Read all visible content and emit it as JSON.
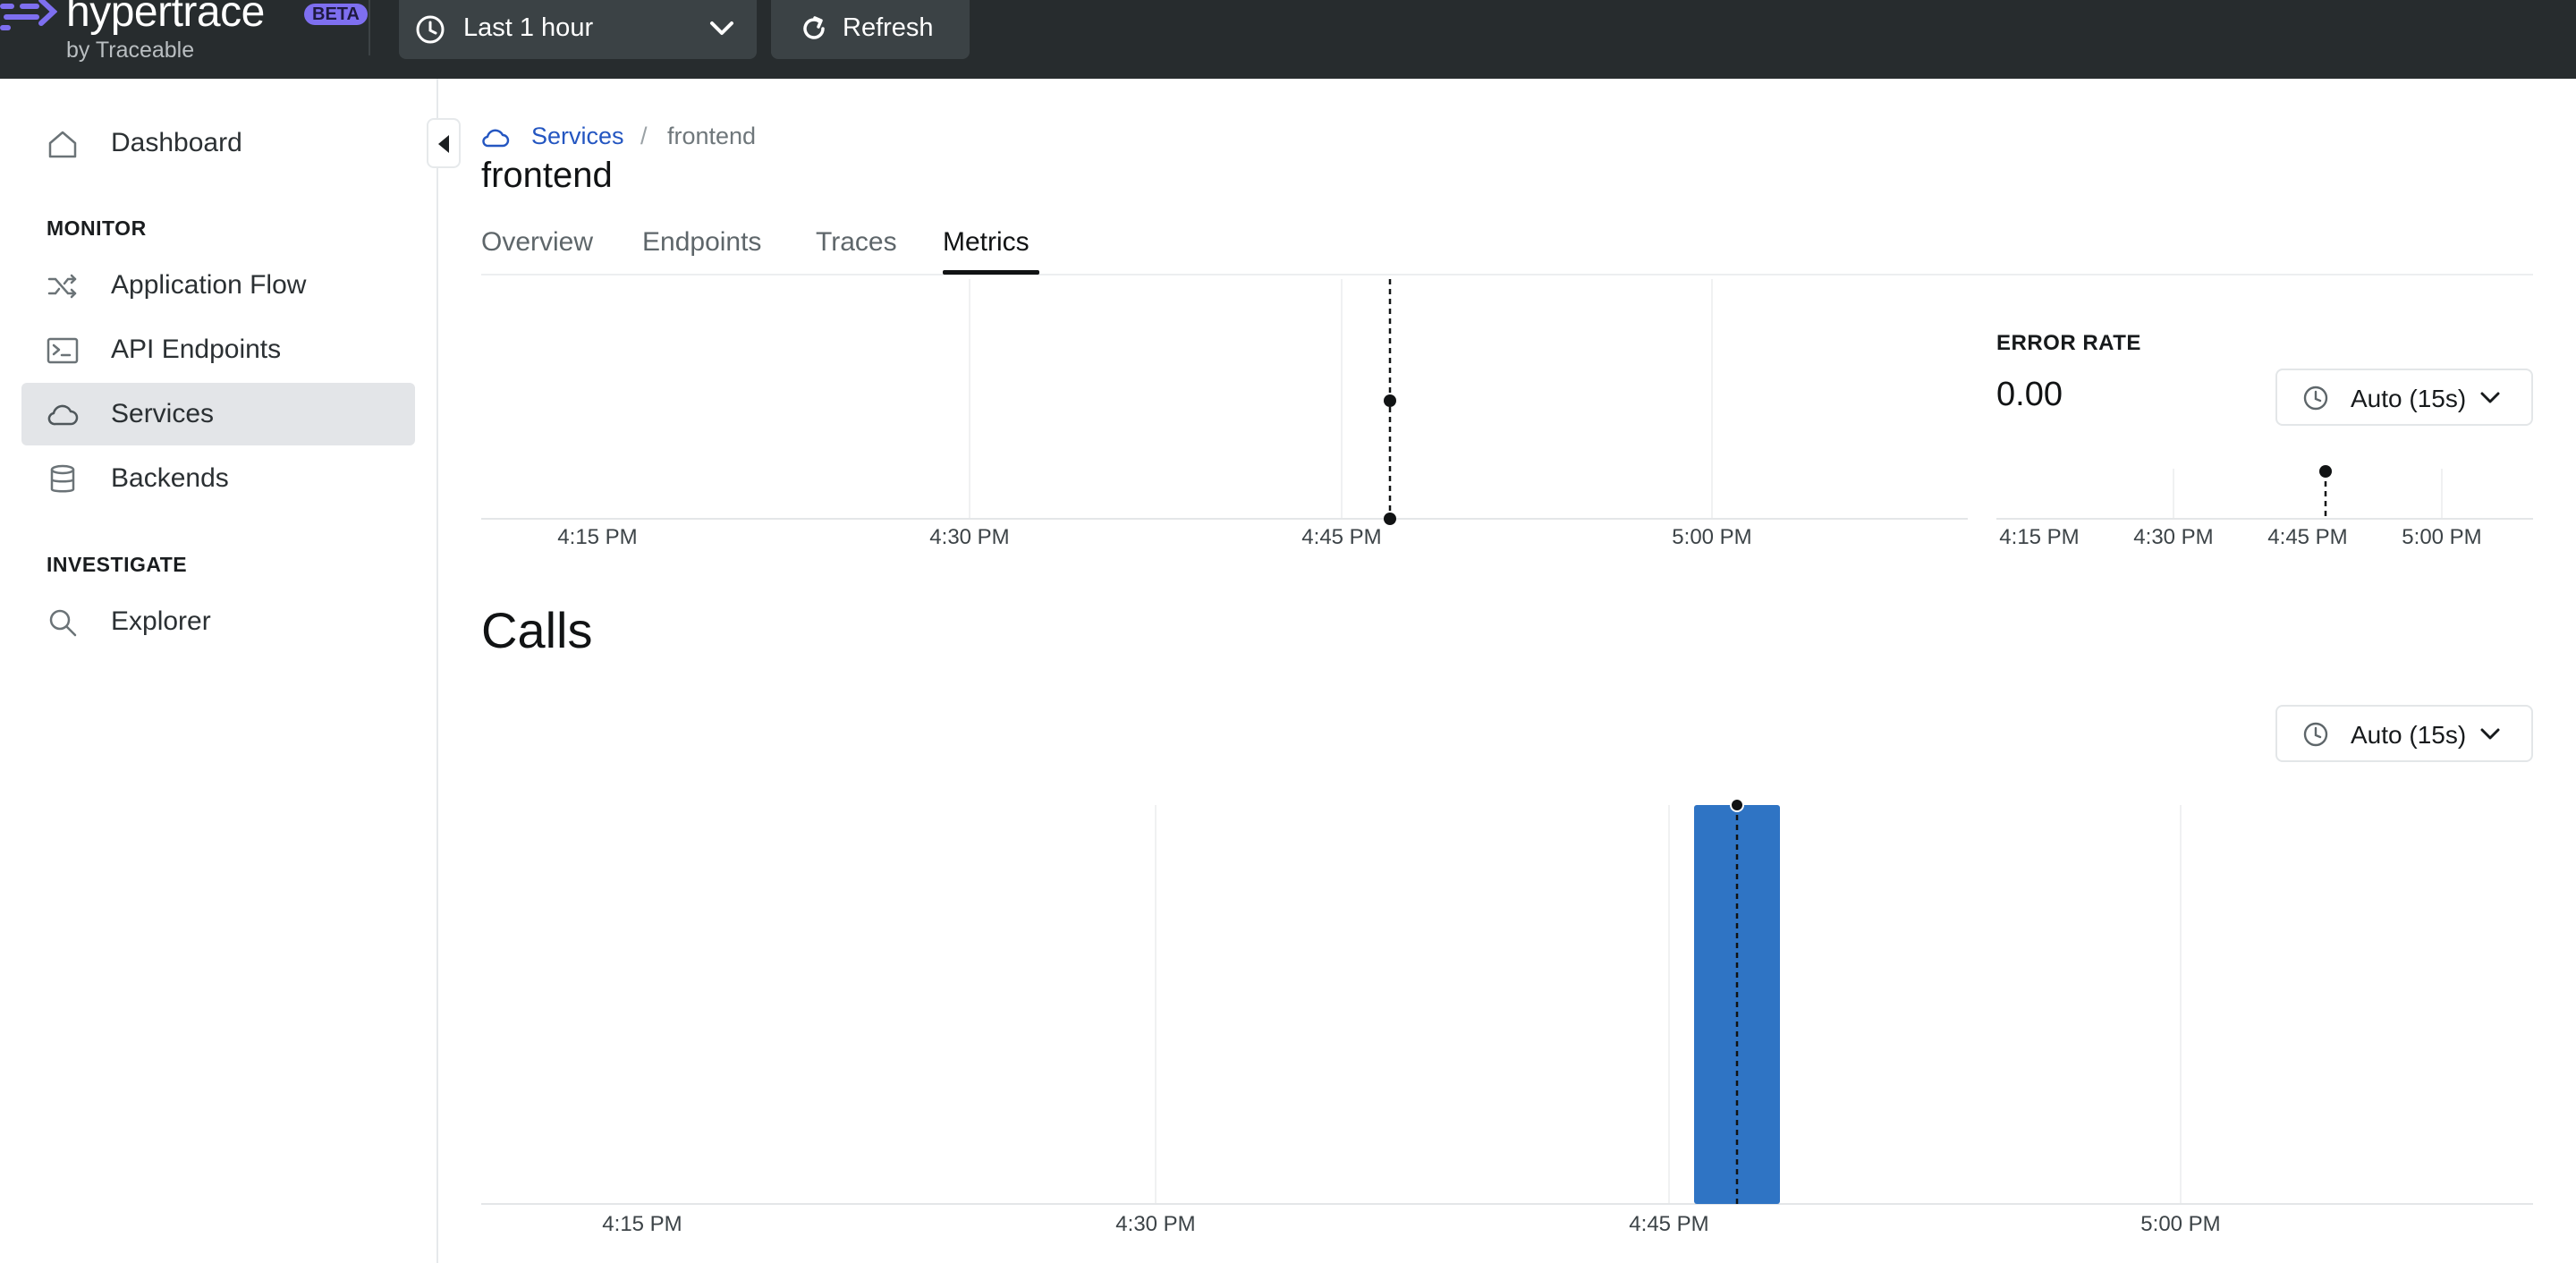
{
  "topbar": {
    "brand": "hypertrace",
    "beta": "BETA",
    "byline": "by Traceable",
    "time_range": "Last 1 hour",
    "refresh_label": "Refresh"
  },
  "sidebar": {
    "items": {
      "dashboard": "Dashboard",
      "application_flow": "Application Flow",
      "api_endpoints": "API Endpoints",
      "services": "Services",
      "backends": "Backends",
      "explorer": "Explorer"
    },
    "sections": {
      "monitor": "MONITOR",
      "investigate": "INVESTIGATE"
    },
    "active": "services"
  },
  "breadcrumb": {
    "link": "Services",
    "separator": "/",
    "current": "frontend"
  },
  "page_title": "frontend",
  "tabs": {
    "overview": "Overview",
    "endpoints": "Endpoints",
    "traces": "Traces",
    "metrics": "Metrics"
  },
  "active_tab": "Metrics",
  "colors": {
    "topbar": "#272c2e",
    "accent": "#7e6ff0",
    "link": "#2456c1",
    "bar": "#2f74c4"
  },
  "error_rate": {
    "title": "ERROR RATE",
    "value": "0.00",
    "interval": "Auto (15s)"
  },
  "calls": {
    "title": "Calls",
    "interval": "Auto (15s)"
  },
  "chart_data": [
    {
      "type": "line",
      "series": [
        {
          "x": [
            "4:46 PM"
          ],
          "y": [
            0.5
          ]
        }
      ],
      "x_ticks": [
        "4:15 PM",
        "4:30 PM",
        "4:45 PM",
        "5:00 PM"
      ],
      "hover_x": "4:46 PM",
      "grid": "vertical"
    },
    {
      "type": "line",
      "title": "ERROR RATE",
      "series": [
        {
          "x": [
            "4:46 PM"
          ],
          "y": [
            0
          ]
        }
      ],
      "x_ticks": [
        "4:15 PM",
        "4:30 PM",
        "4:45 PM",
        "5:00 PM"
      ],
      "grid": "vertical"
    },
    {
      "type": "bar",
      "title": "Calls",
      "categories": [
        "4:46 PM"
      ],
      "values": [
        1
      ],
      "x_ticks": [
        "4:15 PM",
        "4:30 PM",
        "4:45 PM",
        "5:00 PM"
      ],
      "hover_x": "4:46 PM",
      "grid": "vertical"
    }
  ]
}
